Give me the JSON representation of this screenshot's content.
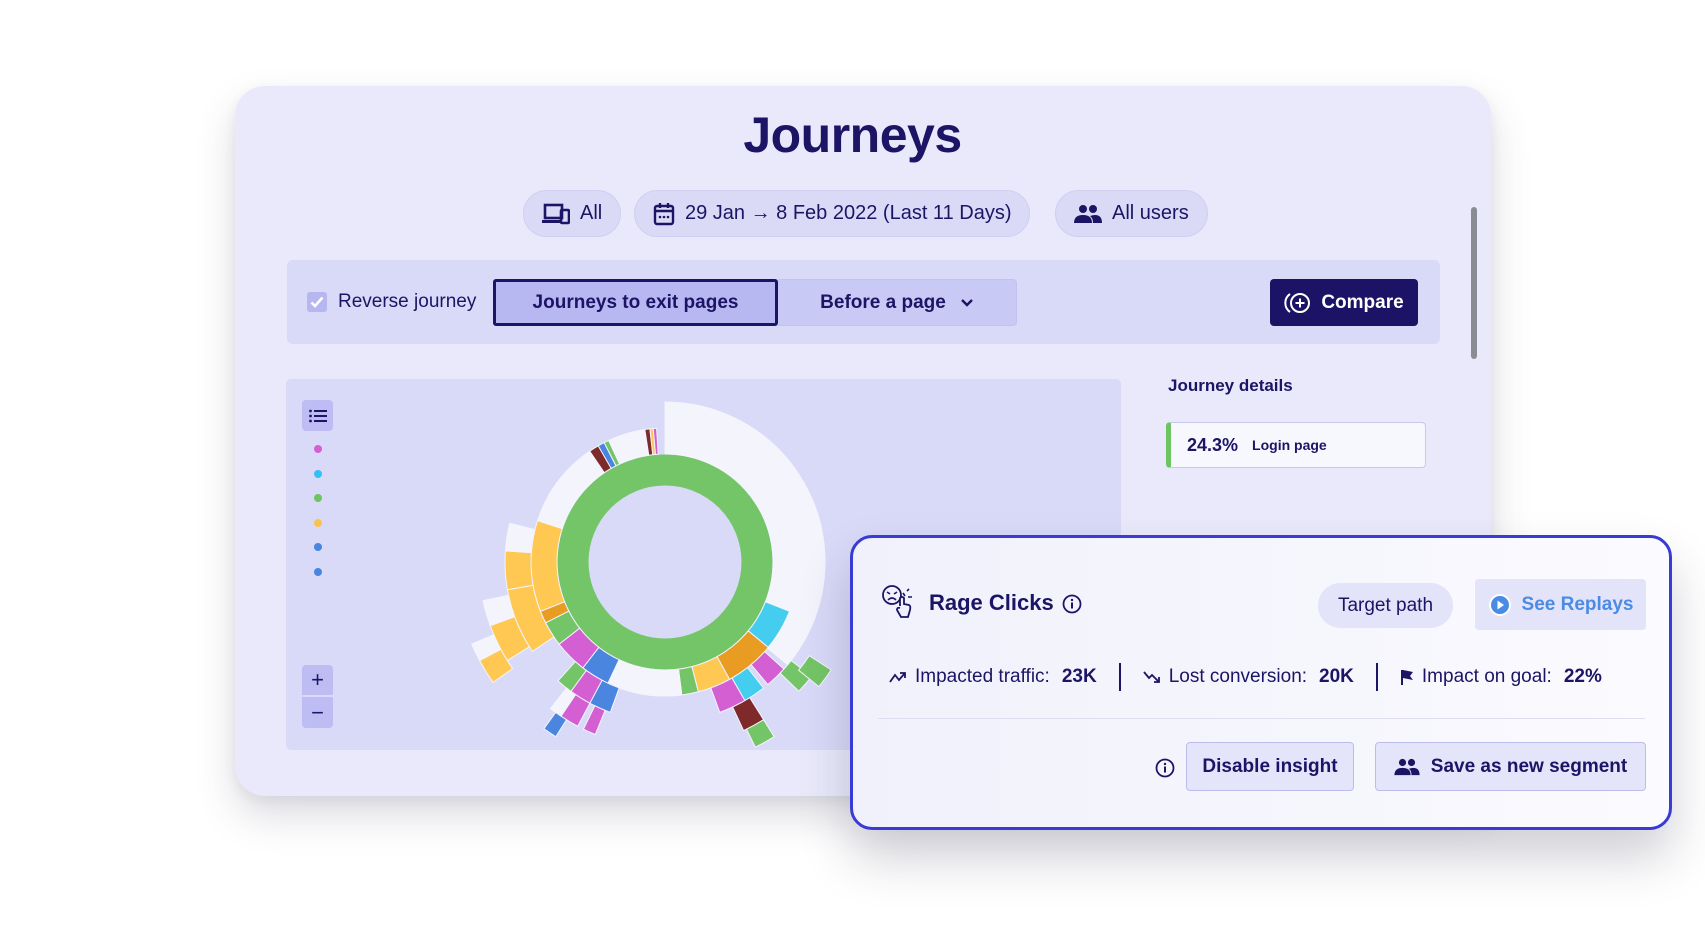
{
  "page": {
    "title": "Journeys"
  },
  "filters": {
    "device": {
      "label": "All",
      "icon": "devices-icon"
    },
    "date": {
      "label": "29 Jan → 8 Feb 2022 (Last 11 Days)",
      "icon": "calendar-icon"
    },
    "users": {
      "label": "All users",
      "icon": "users-icon"
    }
  },
  "toolbar": {
    "reverse_journey": {
      "label": "Reverse journey",
      "checked": true
    },
    "mode_active": "Journeys to exit pages",
    "mode_dropdown": "Before a page",
    "compare_label": "Compare"
  },
  "chart_panel": {
    "legend_colors": [
      "#d35fd3",
      "#33c1f2",
      "#6cc561",
      "#f9c34c",
      "#4a86e0",
      "#4a86e0"
    ],
    "zoom_in": "+",
    "zoom_out": "−"
  },
  "chart_data": {
    "type": "sunburst",
    "title": "",
    "levels": [
      {
        "level": 1,
        "segments": [
          {
            "name": "Login page",
            "share": 1.0,
            "color": "#74c567"
          }
        ]
      },
      {
        "level": 2,
        "segments": [
          {
            "name": "none",
            "share": 0.31,
            "color": "#f4f4fd"
          },
          {
            "name": "cyan",
            "share": 0.05,
            "color": "#44cdef"
          },
          {
            "name": "orange",
            "share": 0.06,
            "color": "#e89c22"
          },
          {
            "name": "yellow",
            "share": 0.04,
            "color": "#fec852"
          },
          {
            "name": "green",
            "share": 0.02,
            "color": "#74c567"
          },
          {
            "name": "none",
            "share": 0.09,
            "color": "#f4f4fd"
          },
          {
            "name": "blue",
            "share": 0.035,
            "color": "#4a86e0"
          },
          {
            "name": "magenta",
            "share": 0.04,
            "color": "#d35fd3"
          },
          {
            "name": "green",
            "share": 0.03,
            "color": "#74c567"
          },
          {
            "name": "orange",
            "share": 0.015,
            "color": "#e89c22"
          },
          {
            "name": "yellow",
            "share": 0.11,
            "color": "#fec852"
          },
          {
            "name": "none",
            "share": 0.07,
            "color": "#f4f4fd"
          },
          {
            "name": "none",
            "share": 0.035,
            "color": "#f4f4fd"
          },
          {
            "name": "maroon",
            "share": 0.012,
            "color": "#7f2a2a"
          },
          {
            "name": "blue",
            "share": 0.008,
            "color": "#4a86e0"
          },
          {
            "name": "green",
            "share": 0.006,
            "color": "#74c567"
          },
          {
            "name": "none",
            "share": 0.045,
            "color": "#f4f4fd"
          },
          {
            "name": "maroon",
            "share": 0.006,
            "color": "#7f2a2a"
          },
          {
            "name": "yellow",
            "share": 0.004,
            "color": "#fec852"
          },
          {
            "name": "magenta",
            "share": 0.004,
            "color": "#d35fd3"
          },
          {
            "name": "gap",
            "share": 0.04,
            "color": "none"
          }
        ]
      }
    ],
    "center_label": ""
  },
  "details": {
    "title": "Journey details",
    "items": [
      {
        "pct": "24.3%",
        "label": "Login page",
        "color": "#6cc561"
      }
    ]
  },
  "insight": {
    "title": "Rage Clicks",
    "target_path_label": "Target path",
    "replays_label": "See Replays",
    "metrics": [
      {
        "label": "Impacted traffic:",
        "value": "23K",
        "icon": "trend-up-icon"
      },
      {
        "label": "Lost conversion:",
        "value": "20K",
        "icon": "trend-down-icon"
      },
      {
        "label": "Impact on goal:",
        "value": "22%",
        "icon": "flag-icon"
      }
    ],
    "disable_label": "Disable insight",
    "save_segment_label": "Save as new segment"
  }
}
